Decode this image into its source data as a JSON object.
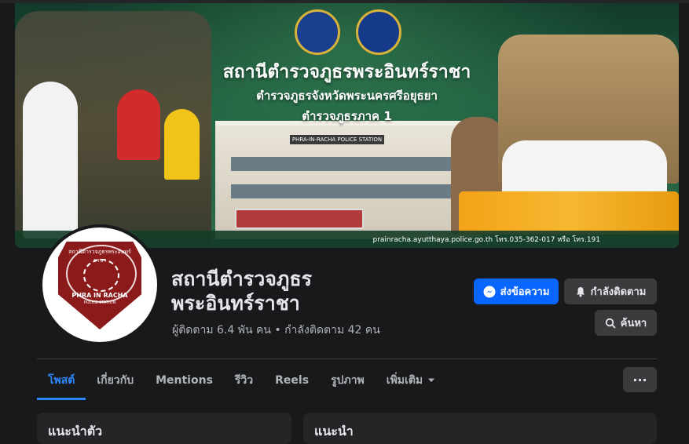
{
  "cover": {
    "title": "สถานีตำรวจภูธรพระอินทร์ราชา",
    "subtitle1": "ตำรวจภูธรจังหวัดพระนครศรีอยุธยา",
    "subtitle2": "ตำรวจภูธรภาค 1",
    "station_sign": "PHRA-IN-RACHA POLICE STATION",
    "contact": "prainracha.ayutthaya.police.go.th โทร.035-362-017 หรือ โทร.191"
  },
  "avatar": {
    "top_text": "สถานีตำรวจภูธรพระอินทร์ราชา",
    "name": "PHRA IN RACHA",
    "sub": "POLICE STATION"
  },
  "profile": {
    "name_line1": "สถานีตำรวจภูธร",
    "name_line2": "พระอินทร์ราชา",
    "followers": "ผู้ติดตาม 6.4 พัน คน • กำลังติดตาม 42 คน"
  },
  "actions": {
    "message": "ส่งข้อความ",
    "following": "กำลังติดตาม",
    "search": "ค้นหา"
  },
  "tabs": [
    "โพสต์",
    "เกี่ยวกับ",
    "Mentions",
    "รีวิว",
    "Reels",
    "รูปภาพ",
    "เพิ่มเติม"
  ],
  "more_button": "···",
  "cards": {
    "left_title": "แนะนำตัว",
    "right_title": "แนะนำ"
  },
  "colors": {
    "accent": "#0866ff",
    "tab_active": "#2d88ff",
    "background": "#18191a"
  }
}
